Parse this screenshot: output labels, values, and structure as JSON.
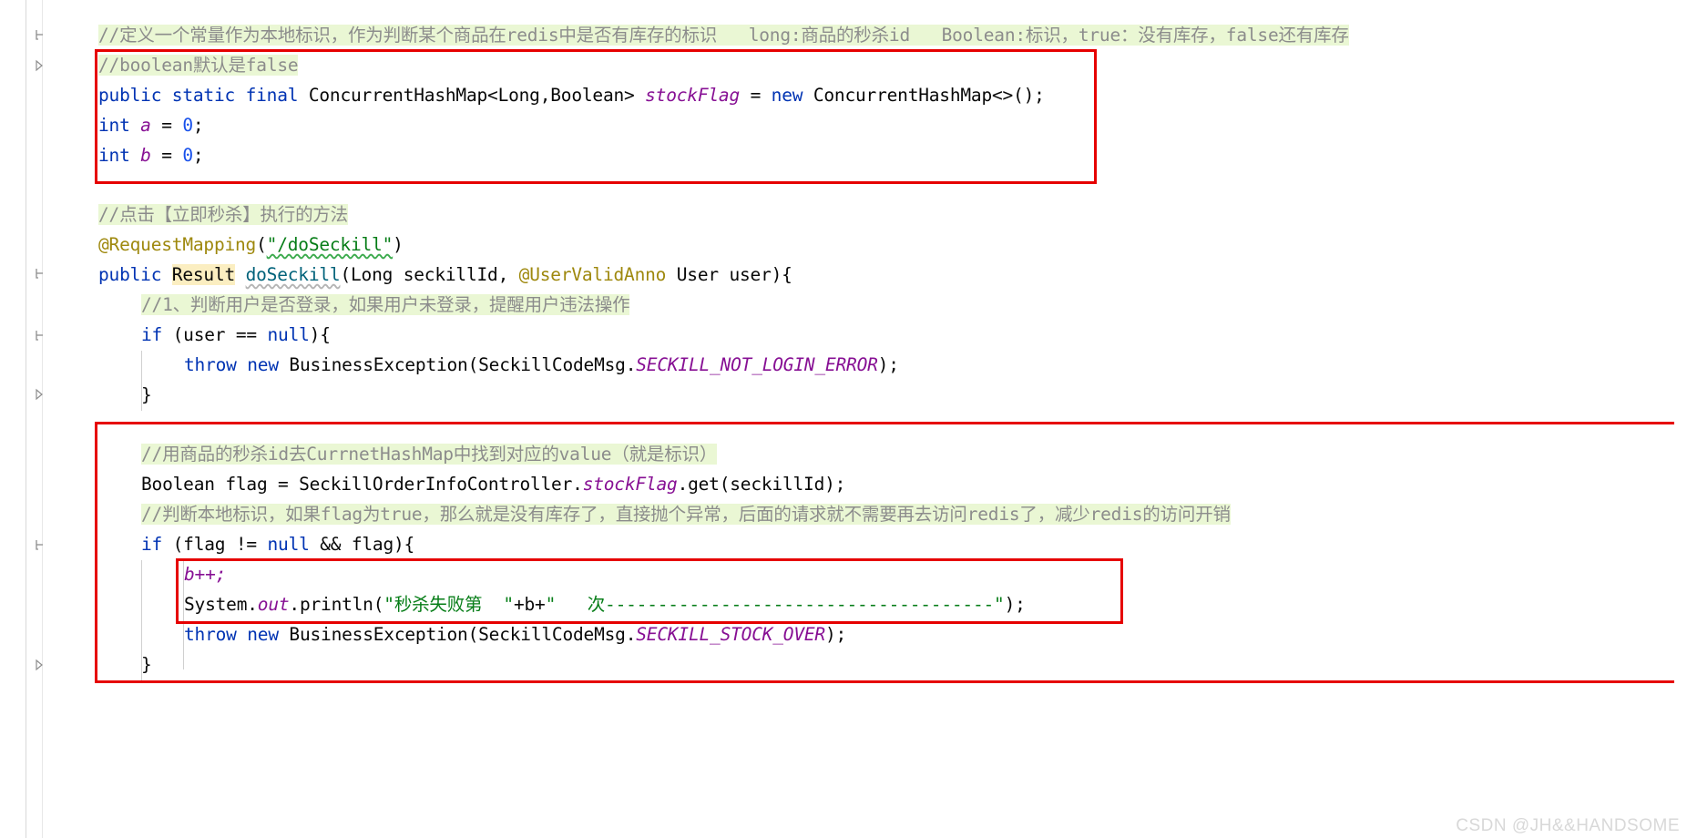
{
  "editor": {
    "language": "java",
    "font_size_px": 19.5,
    "background": "#ffffff",
    "colors": {
      "keyword": "#0033b3",
      "string": "#067d17",
      "comment": "#8c8c8c",
      "comment_highlight_bg": "#eaf7d4",
      "identifier_highlight_bg": "#fbeec1",
      "static_field": "#871094",
      "annotation": "#9e880d",
      "method_declaration": "#00627a",
      "number": "#1750eb",
      "annotation_box_border": "#e60000",
      "text": "#080808"
    }
  },
  "code": {
    "line_01": {
      "comment": "//定义一个常量作为本地标识，作为判断某个商品在redis中是否有库存的标识   long:商品的秒杀id   Boolean:标识，true：没有库存，false还有库存"
    },
    "line_02": {
      "comment": "//boolean默认是false"
    },
    "line_03": {
      "kw_public": "public",
      "kw_static": "static",
      "kw_final": "final",
      "type": "ConcurrentHashMap<Long,Boolean>",
      "field": "stockFlag",
      "equals": "=",
      "kw_new": "new",
      "ctor": "ConcurrentHashMap<>();"
    },
    "line_04": {
      "kw_int": "int",
      "name": "a",
      "equals": "=",
      "value": "0",
      "semi": ";"
    },
    "line_05": {
      "kw_int": "int",
      "name": "b",
      "equals": "=",
      "value": "0",
      "semi": ";"
    },
    "line_06": {
      "comment": "//点击【立即秒杀】执行的方法"
    },
    "line_07": {
      "annotation": "@RequestMapping",
      "paren_open": "(",
      "string": "\"/doSeckill\"",
      "paren_close": ")"
    },
    "line_08": {
      "kw_public": "public",
      "return_type": "Result",
      "method": "doSeckill",
      "params_a": "(Long seckillId, ",
      "param_anno": "@UserValidAnno",
      "params_b": " User user){"
    },
    "line_09": {
      "comment": "//1、判断用户是否登录，如果用户未登录，提醒用户违法操作"
    },
    "line_10": {
      "kw_if": "if",
      "cond_a": " (user == ",
      "kw_null": "null",
      "cond_b": "){"
    },
    "line_11": {
      "kw_throw": "throw",
      "kw_new": "new",
      "expr_a": "BusinessException(SeckillCodeMsg.",
      "constant": "SECKILL_NOT_LOGIN_ERROR",
      "expr_b": ");"
    },
    "line_12": {
      "brace": "}"
    },
    "line_13": {
      "comment": "//用商品的秒杀id去CurrnetHashMap中找到对应的value（就是标识）"
    },
    "line_14": {
      "expr_a": "Boolean flag = SeckillOrderInfoController.",
      "field": "stockFlag",
      "expr_b": ".get(seckillId);"
    },
    "line_15": {
      "comment": "//判断本地标识，如果flag为true，那么就是没有库存了，直接抛个异常，后面的请求就不需要再去访问redis了，减少redis的访问开销"
    },
    "line_16": {
      "kw_if": "if",
      "cond_a": " (flag != ",
      "kw_null": "null",
      "cond_b": " && flag){"
    },
    "line_17": {
      "stmt": "b++;"
    },
    "line_18": {
      "expr_a": "System.",
      "field_out": "out",
      "expr_b": ".println(",
      "string": "\"秒杀失败第  \"",
      "concat_a": "+b+",
      "string2": "\"   次-------------------------------------\"",
      "expr_c": ");"
    },
    "line_19": {
      "kw_throw": "throw",
      "kw_new": "new",
      "expr_a": "BusinessException(SeckillCodeMsg.",
      "constant": "SECKILL_STOCK_OVER",
      "expr_b": ");"
    },
    "line_20": {
      "brace": "}"
    }
  },
  "annotation_boxes": [
    {
      "name": "box-stock-flag-declaration"
    },
    {
      "name": "box-local-flag-check"
    },
    {
      "name": "box-fail-counter-print"
    }
  ],
  "gutter": {
    "fold_markers": [
      {
        "name": "fold-collapse-1",
        "glyph": "minus"
      },
      {
        "name": "fold-end-1",
        "glyph": "end"
      },
      {
        "name": "fold-collapse-2",
        "glyph": "minus"
      },
      {
        "name": "fold-collapse-3",
        "glyph": "minus"
      },
      {
        "name": "fold-end-2",
        "glyph": "end"
      },
      {
        "name": "fold-collapse-4",
        "glyph": "minus"
      },
      {
        "name": "fold-end-3",
        "glyph": "end"
      }
    ]
  },
  "watermark": {
    "text": "CSDN @JH&&HANDSOME"
  }
}
